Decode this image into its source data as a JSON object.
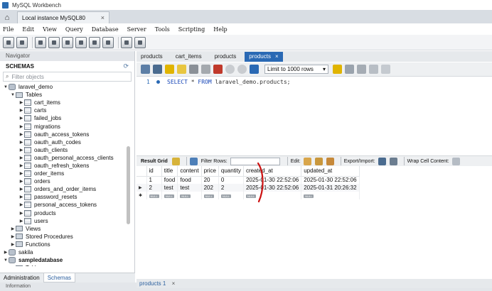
{
  "window": {
    "title": "MySQL Workbench"
  },
  "connection_tab": {
    "label": "Local instance MySQL80",
    "close": "×"
  },
  "menu": [
    "File",
    "Edit",
    "View",
    "Query",
    "Database",
    "Server",
    "Tools",
    "Scripting",
    "Help"
  ],
  "navigator": {
    "header": "Navigator",
    "schemas_label": "SCHEMAS",
    "filter_placeholder": "Filter objects",
    "tree": [
      {
        "label": "laravel_demo",
        "level": 0,
        "kind": "db",
        "open": true
      },
      {
        "label": "Tables",
        "level": 1,
        "kind": "folder",
        "open": true
      },
      {
        "label": "cart_items",
        "level": 2,
        "kind": "table"
      },
      {
        "label": "carts",
        "level": 2,
        "kind": "table"
      },
      {
        "label": "failed_jobs",
        "level": 2,
        "kind": "table"
      },
      {
        "label": "migrations",
        "level": 2,
        "kind": "table"
      },
      {
        "label": "oauth_access_tokens",
        "level": 2,
        "kind": "table"
      },
      {
        "label": "oauth_auth_codes",
        "level": 2,
        "kind": "table"
      },
      {
        "label": "oauth_clients",
        "level": 2,
        "kind": "table"
      },
      {
        "label": "oauth_personal_access_clients",
        "level": 2,
        "kind": "table"
      },
      {
        "label": "oauth_refresh_tokens",
        "level": 2,
        "kind": "table"
      },
      {
        "label": "order_items",
        "level": 2,
        "kind": "table"
      },
      {
        "label": "orders",
        "level": 2,
        "kind": "table"
      },
      {
        "label": "orders_and_order_items",
        "level": 2,
        "kind": "table"
      },
      {
        "label": "password_resets",
        "level": 2,
        "kind": "table"
      },
      {
        "label": "personal_access_tokens",
        "level": 2,
        "kind": "table"
      },
      {
        "label": "products",
        "level": 2,
        "kind": "table"
      },
      {
        "label": "users",
        "level": 2,
        "kind": "table"
      },
      {
        "label": "Views",
        "level": 1,
        "kind": "folder",
        "open": false
      },
      {
        "label": "Stored Procedures",
        "level": 1,
        "kind": "folder",
        "open": false
      },
      {
        "label": "Functions",
        "level": 1,
        "kind": "folder",
        "open": false
      },
      {
        "label": "sakila",
        "level": 0,
        "kind": "db",
        "open": false
      },
      {
        "label": "sampledatabase",
        "level": 0,
        "kind": "db",
        "open": true,
        "bold": true
      },
      {
        "label": "Tables",
        "level": 1,
        "kind": "folder",
        "open": false
      }
    ],
    "tabs": [
      "Administration",
      "Schemas"
    ],
    "active_tab": "Schemas"
  },
  "info_header": "Information",
  "editor": {
    "tabs": [
      "products",
      "cart_items",
      "products",
      "products"
    ],
    "active_tab_index": 3,
    "close": "×",
    "limit_label": "Limit to 1000 rows",
    "line_number": "1",
    "sql_keywords": [
      "SELECT",
      "FROM"
    ],
    "sql_star": "*",
    "sql_target": "laravel_demo.products;"
  },
  "result_toolbar": {
    "result_grid": "Result Grid",
    "filter_rows": "Filter Rows:",
    "edit": "Edit:",
    "export_import": "Export/Import:",
    "wrap": "Wrap Cell Content:"
  },
  "grid": {
    "columns": [
      "id",
      "title",
      "content",
      "price",
      "quantity",
      "created_at",
      "updated_at"
    ],
    "rows": [
      [
        "1",
        "food",
        "food",
        "20",
        "0",
        "2025-01-30 22:52:06",
        "2025-01-30 22:52:06"
      ],
      [
        "2",
        "test",
        "test",
        "202",
        "2",
        "2025-01-30 22:52:06",
        "2025-01-31 20:26:32"
      ]
    ],
    "null_label": "NULL",
    "selected_row": 1
  },
  "result_bottom": {
    "tab": "products 1",
    "close": "×"
  },
  "colors": {
    "accent": "#2a69b4",
    "annotation": "#cc1111"
  }
}
